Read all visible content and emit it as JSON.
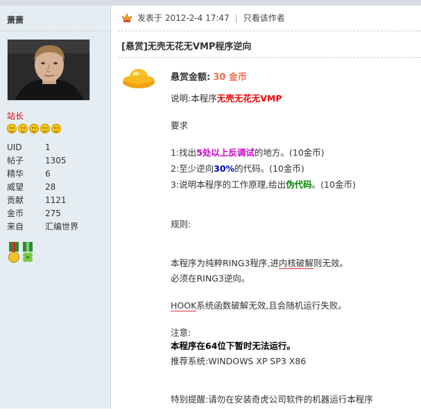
{
  "sidebar": {
    "author": "萧萧",
    "rank": "站长",
    "stats": [
      {
        "label": "UID",
        "value": "1"
      },
      {
        "label": "帖子",
        "value": "1305"
      },
      {
        "label": "精华",
        "value": "6"
      },
      {
        "label": "威望",
        "value": "28"
      },
      {
        "label": "贡献",
        "value": "1121"
      },
      {
        "label": "金币",
        "value": "275"
      },
      {
        "label": "来自",
        "value": "汇编世界"
      }
    ]
  },
  "post": {
    "posted_label": "发表于 2012-2-4 17:47",
    "separator": "|",
    "author_only": "只看该作者",
    "title": "[悬赏]无壳无花无VMP程序逆向",
    "reward_label": "悬赏金额:",
    "reward_amount": "30 金币",
    "desc_prefix": "说明:本程序",
    "desc_highlight": "无壳无花无VMP",
    "requirements_label": "要求",
    "req1_prefix": "1:找出",
    "req1_highlight": "5处以上反调试",
    "req1_suffix": "的地方。(10金币)",
    "req2_prefix": "2:至少逆向",
    "req2_highlight": "30%",
    "req2_suffix": "的代码。(10金币)",
    "req3_prefix": "3:说明本程序的工作原理,给出",
    "req3_highlight": "伪代码",
    "req3_suffix": "。(10金币)",
    "rules_label": "规则:",
    "rule1_prefix": "本程序为纯粹RING3程序,进",
    "rule1_underlined": "内核破解",
    "rule1_suffix": "则无效。",
    "rule2": "必须在RING3逆向。",
    "rule3_underlined": "HOOK",
    "rule3_suffix": "系统函数破解无效,且会随机运行失败。",
    "note_label": "注意:",
    "note_bold": "本程序在64位下暂时无法运行。",
    "recommend": "推荐系统:WINDOWS XP SP3 X86",
    "special": "特别提醒:请勿在安装奇虎公司软件的机器运行本程序"
  }
}
